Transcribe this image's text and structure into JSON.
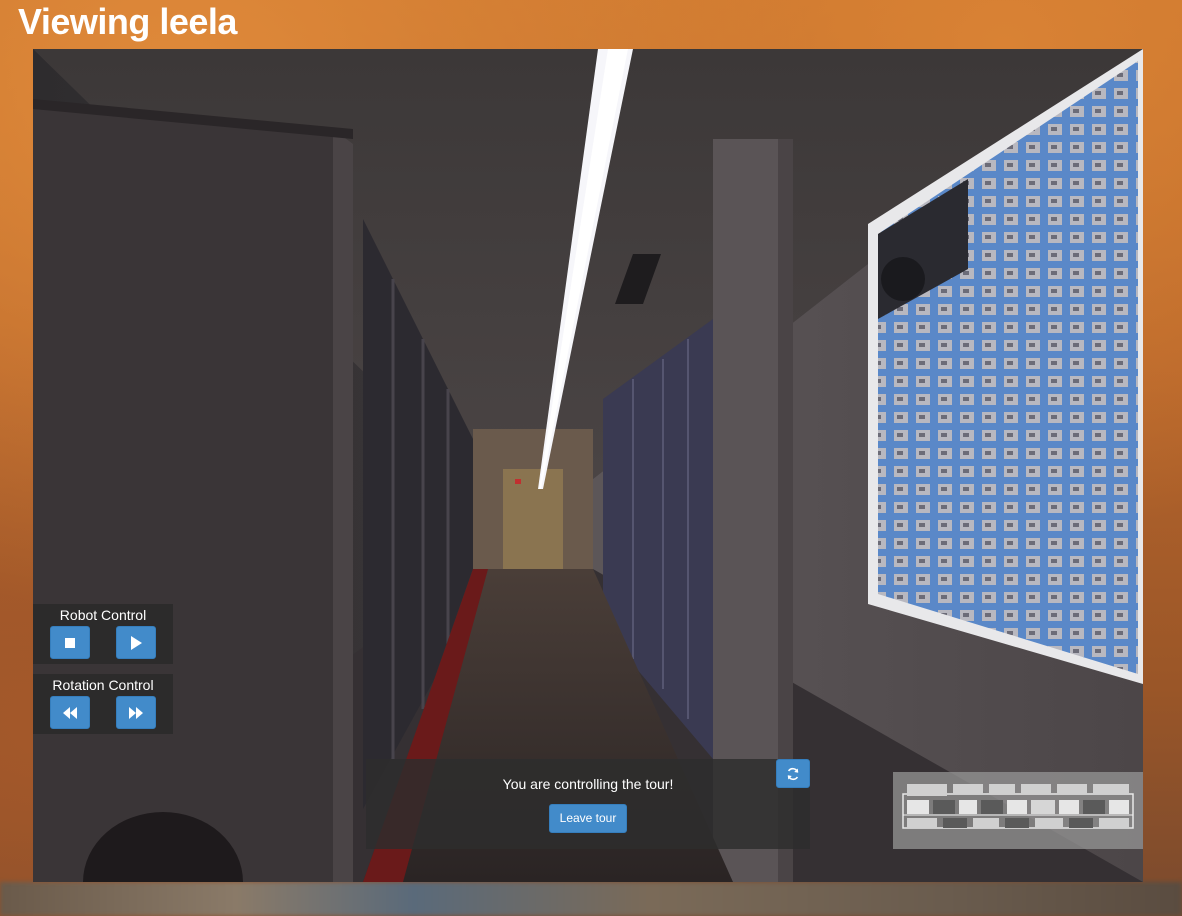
{
  "page": {
    "title": "Viewing leela"
  },
  "robot_control": {
    "label": "Robot Control",
    "stop_icon": "stop-icon",
    "play_icon": "play-icon"
  },
  "rotation_control": {
    "label": "Rotation Control",
    "rotate_left_icon": "backward-icon",
    "rotate_right_icon": "forward-icon"
  },
  "tour": {
    "message": "You are controlling the tour!",
    "leave_label": "Leave tour",
    "refresh_icon": "refresh-icon"
  },
  "minimap": {
    "icon": "floor-map"
  },
  "colors": {
    "button_primary": "#428bca",
    "title_text": "#ffffff",
    "panel_bg": "#282828"
  }
}
